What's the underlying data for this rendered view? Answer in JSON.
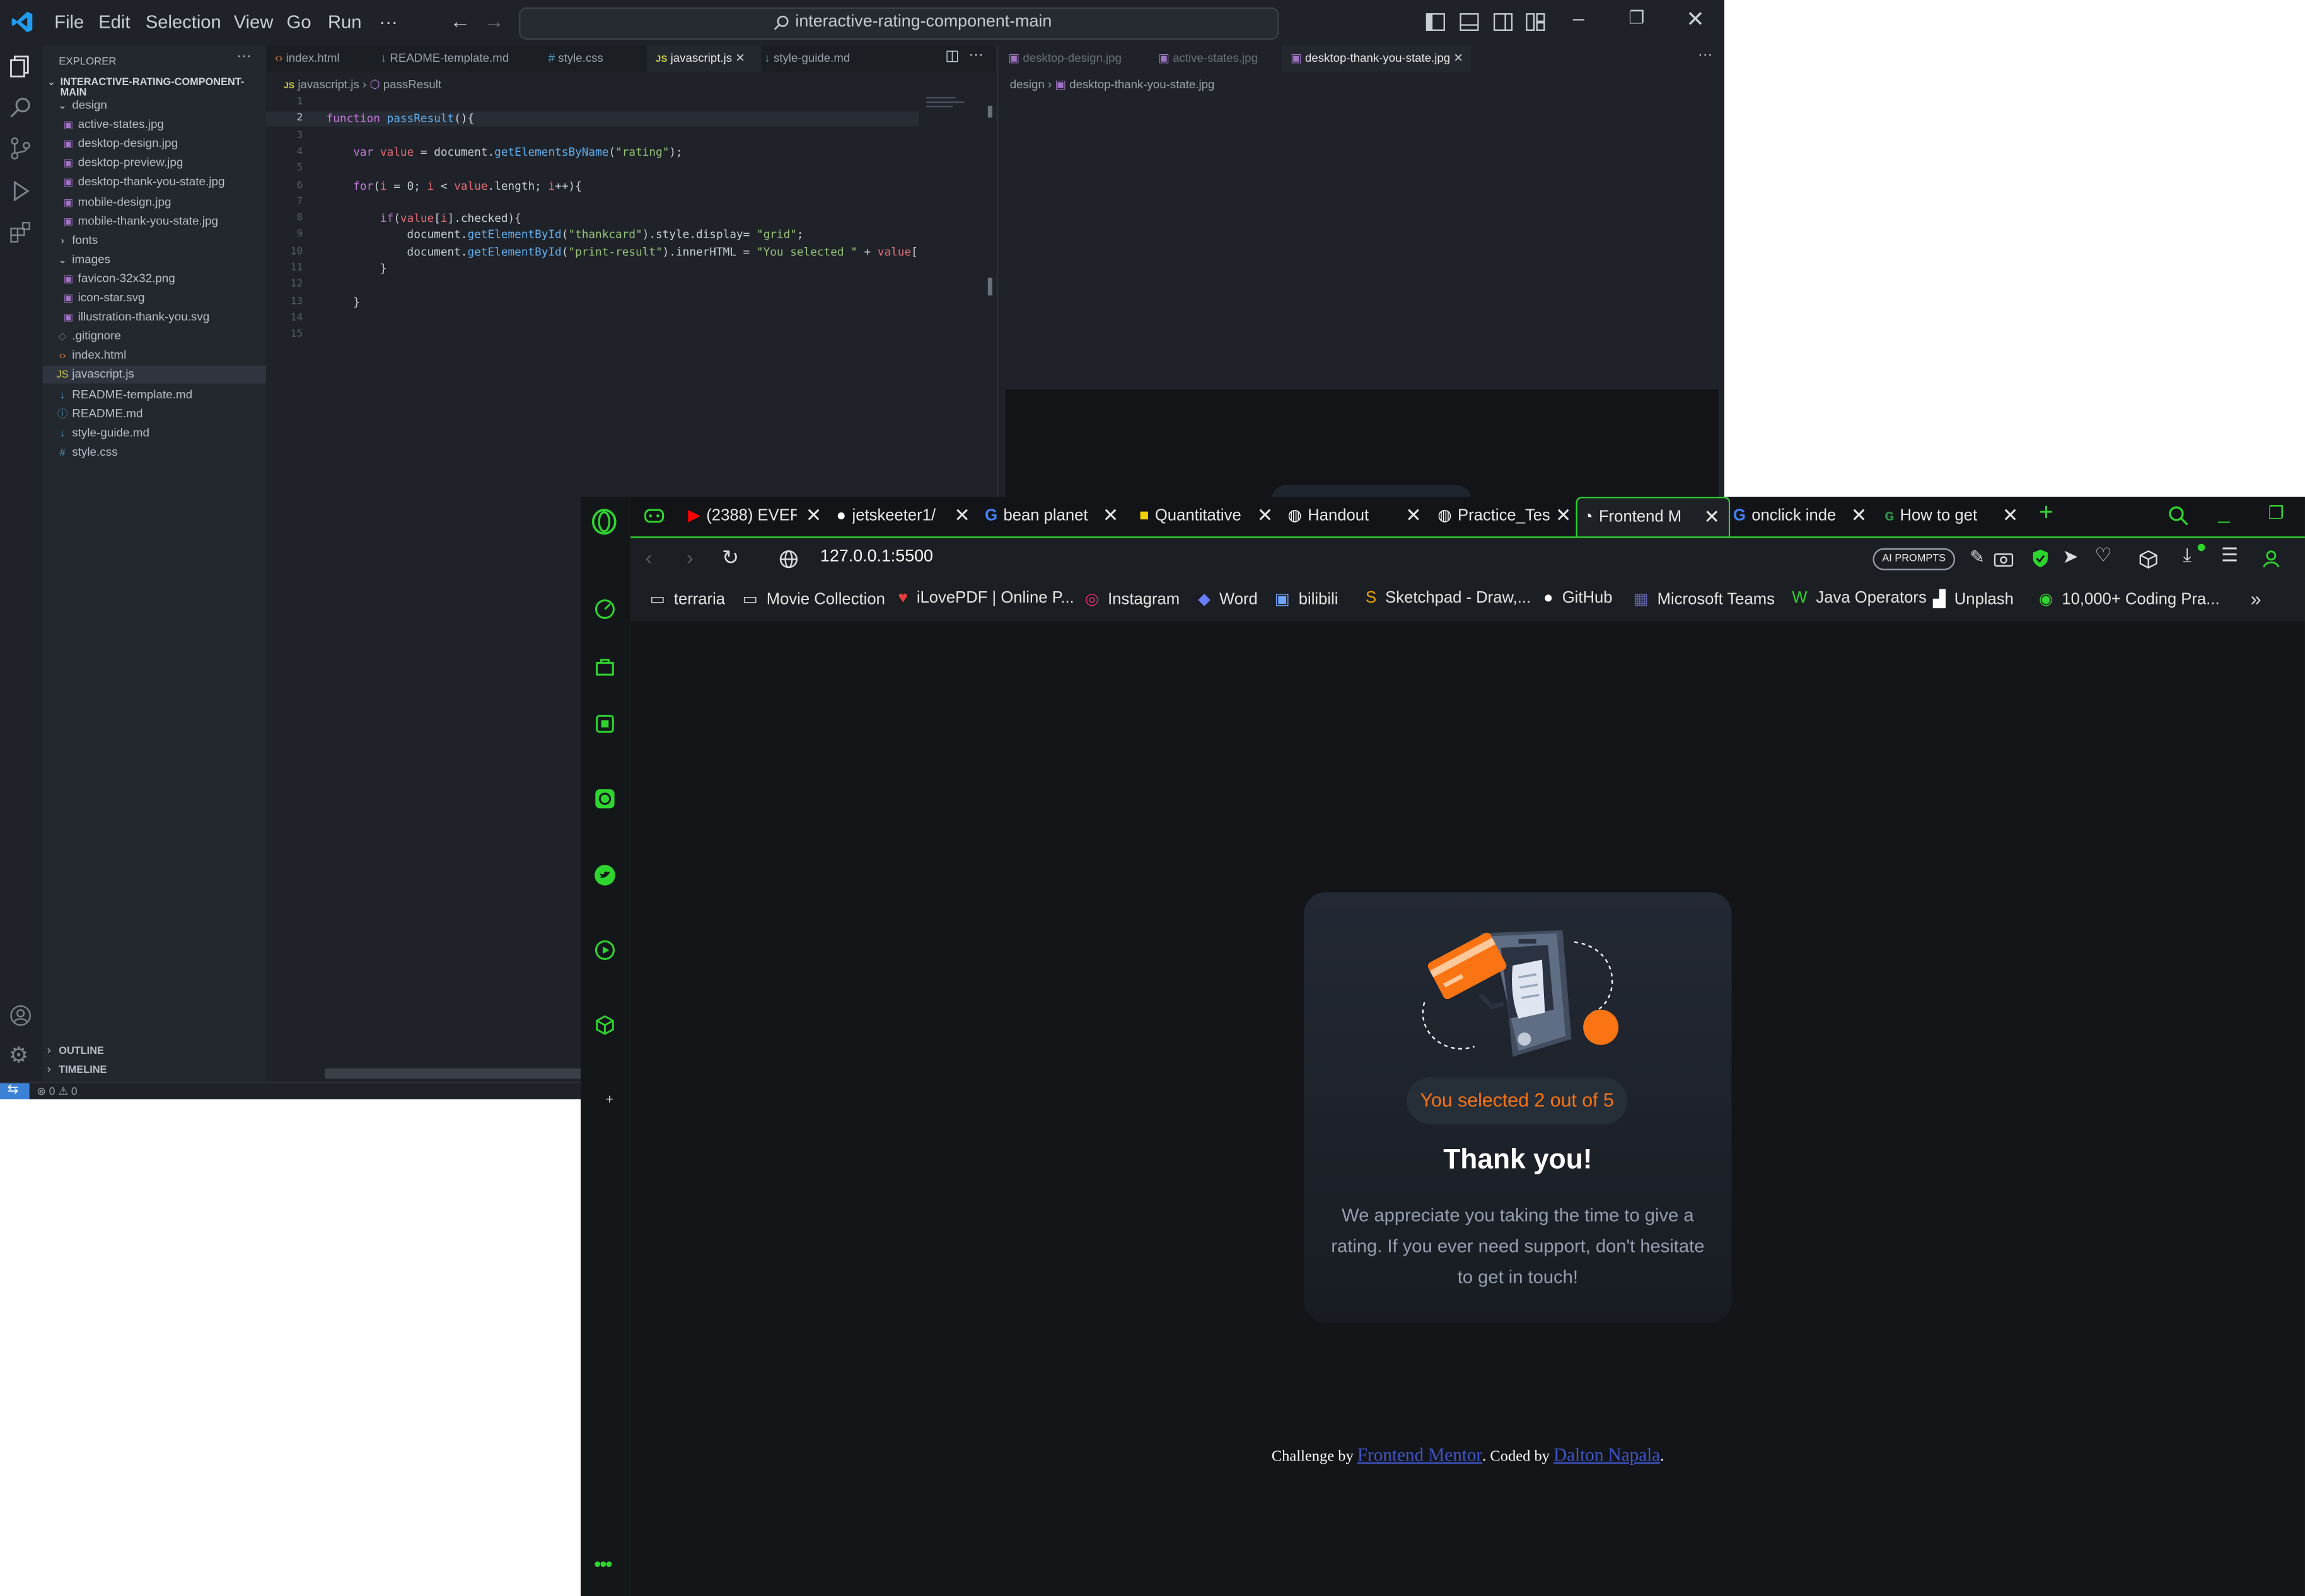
{
  "vscode": {
    "menu": [
      "File",
      "Edit",
      "Selection",
      "View",
      "Go",
      "Run",
      "···"
    ],
    "search_text": "interactive-rating-component-main",
    "explorer_title": "EXPLORER",
    "project_name": "INTERACTIVE-RATING-COMPONENT-MAIN",
    "tree": [
      {
        "label": "design",
        "type": "folder",
        "depth": 1
      },
      {
        "label": "active-states.jpg",
        "type": "img",
        "depth": 2
      },
      {
        "label": "desktop-design.jpg",
        "type": "img",
        "depth": 2
      },
      {
        "label": "desktop-preview.jpg",
        "type": "img",
        "depth": 2
      },
      {
        "label": "desktop-thank-you-state.jpg",
        "type": "img",
        "depth": 2
      },
      {
        "label": "mobile-design.jpg",
        "type": "img",
        "depth": 2
      },
      {
        "label": "mobile-thank-you-state.jpg",
        "type": "img",
        "depth": 2
      },
      {
        "label": "fonts",
        "type": "folder-closed",
        "depth": 1
      },
      {
        "label": "images",
        "type": "folder",
        "depth": 1
      },
      {
        "label": "favicon-32x32.png",
        "type": "img",
        "depth": 2
      },
      {
        "label": "icon-star.svg",
        "type": "img",
        "depth": 2
      },
      {
        "label": "illustration-thank-you.svg",
        "type": "img",
        "depth": 2
      },
      {
        "label": ".gitignore",
        "type": "file",
        "depth": 1
      },
      {
        "label": "index.html",
        "type": "html",
        "depth": 1
      },
      {
        "label": "javascript.js",
        "type": "js",
        "depth": 1
      },
      {
        "label": "README-template.md",
        "type": "md",
        "depth": 1
      },
      {
        "label": "README.md",
        "type": "info",
        "depth": 1
      },
      {
        "label": "style-guide.md",
        "type": "md",
        "depth": 1
      },
      {
        "label": "style.css",
        "type": "css",
        "depth": 1
      }
    ],
    "outline_label": "OUTLINE",
    "timeline_label": "TIMELINE",
    "tabs": [
      "index.html",
      "README-template.md",
      "style.css",
      "javascript.js",
      "style-guide.md"
    ],
    "active_tab": "javascript.js",
    "breadcrumb": [
      "javascript.js",
      "passResult"
    ],
    "right_tabs": [
      "desktop-design.jpg",
      "active-states.jpg",
      "desktop-thank-you-state.jpg"
    ],
    "right_breadcrumb": [
      "design",
      "desktop-thank-you-state.jpg"
    ],
    "code": [
      "",
      "function passResult(){",
      "",
      "    var value = document.getElementsByName(\"rating\");",
      "",
      "    for(i = 0; i < value.length; i++){",
      "",
      "        if(value[i].checked){",
      "            document.getElementById(\"thankcard\").style.display= \"grid\";",
      "            document.getElementById(\"print-result\").innerHTML = \"You selected \" + value[",
      "        }",
      "",
      "    }",
      "",
      ""
    ],
    "status": "⊗ 0 ⚠ 0"
  },
  "opera": {
    "tabs": [
      {
        "label": "(2388) EVER",
        "icon": "youtube-icon"
      },
      {
        "label": "jetskeeter1/",
        "icon": "github-icon"
      },
      {
        "label": "bean planet",
        "icon": "google-icon"
      },
      {
        "label": "Quantitative",
        "icon": "isn-icon"
      },
      {
        "label": "Handout",
        "icon": "globe-icon"
      },
      {
        "label": "Practice_Tes",
        "icon": "globe-icon"
      },
      {
        "label": "Frontend M",
        "icon": "favicon-icon"
      },
      {
        "label": "onclick inde",
        "icon": "google-icon"
      },
      {
        "label": "How to get",
        "icon": "geeks-icon"
      }
    ],
    "url": "127.0.0.1:5500",
    "ai_prompts_label": "AI PROMPTS",
    "bookmarks": [
      "terraria",
      "Movie Collection",
      "iLovePDF | Online P...",
      "Instagram",
      "Word",
      "bilibili",
      "Sketchpad - Draw,...",
      "GitHub",
      "Microsoft Teams",
      "Java Operators",
      "Unplash",
      "10,000+ Coding Pra..."
    ],
    "card": {
      "selection_text": "You selected 2 out of 5",
      "title": "Thank you!",
      "body": "We appreciate you taking the time to give a rating. If you ever need support, don't hesitate to get in touch!"
    },
    "attribution": {
      "prefix": "Challenge by ",
      "link1": "Frontend Mentor",
      "middle": ". Coded by ",
      "link2": "Dalton Napala",
      "suffix": "."
    }
  },
  "colors": {
    "opera_accent": "#2fd52f",
    "card_orange": "#fb7413",
    "vscode_bg": "#1f2329"
  }
}
